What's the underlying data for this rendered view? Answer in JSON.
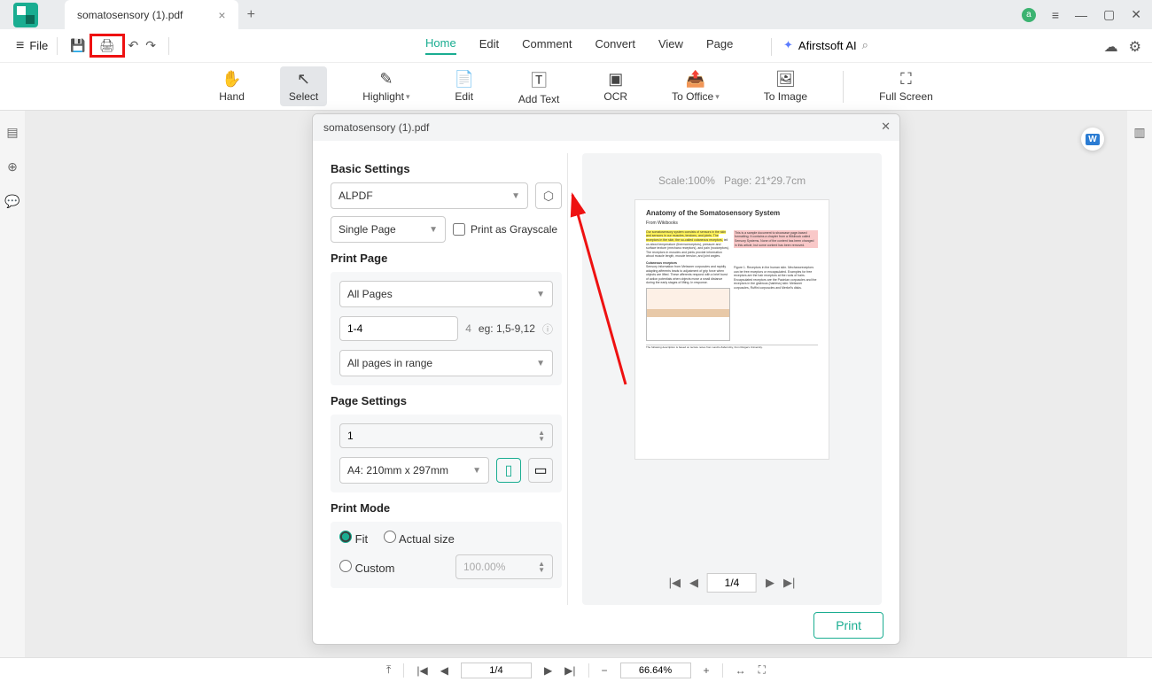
{
  "titlebar": {
    "tab": "somatosensory (1).pdf",
    "avatar": "a"
  },
  "menubar": {
    "file": "File",
    "tabs": {
      "home": "Home",
      "edit": "Edit",
      "comment": "Comment",
      "convert": "Convert",
      "view": "View",
      "page": "Page"
    },
    "ai": "Afirstsoft AI"
  },
  "toolbar": {
    "hand": "Hand",
    "select": "Select",
    "highlight": "Highlight",
    "edit": "Edit",
    "addtext": "Add Text",
    "ocr": "OCR",
    "tooffice": "To Office",
    "toimage": "To Image",
    "fullscreen": "Full Screen"
  },
  "dialog": {
    "title": "somatosensory (1).pdf",
    "basic": {
      "header": "Basic Settings",
      "printer": "ALPDF",
      "layout": "Single Page",
      "grayscale_label": "Print as Grayscale"
    },
    "printpage": {
      "header": "Print Page",
      "range_sel": "All Pages",
      "range_val": "1-4",
      "range_total": "4",
      "range_hint": "eg: 1,5-9,12",
      "subset": "All pages in range"
    },
    "pagesettings": {
      "header": "Page Settings",
      "copies": "1",
      "paper": "A4: 210mm x 297mm"
    },
    "printmode": {
      "header": "Print Mode",
      "fit": "Fit",
      "actual": "Actual size",
      "custom": "Custom",
      "scale": "100.00%"
    },
    "preview": {
      "meta_scale": "Scale:100%",
      "meta_page": "Page: 21*29.7cm",
      "doc_title": "Anatomy of the Somatosensory System",
      "doc_from": "From Wikibooks",
      "nav": "1/4"
    },
    "print_btn": "Print"
  },
  "bottombar": {
    "page": "1/4",
    "zoom": "66.64%"
  }
}
